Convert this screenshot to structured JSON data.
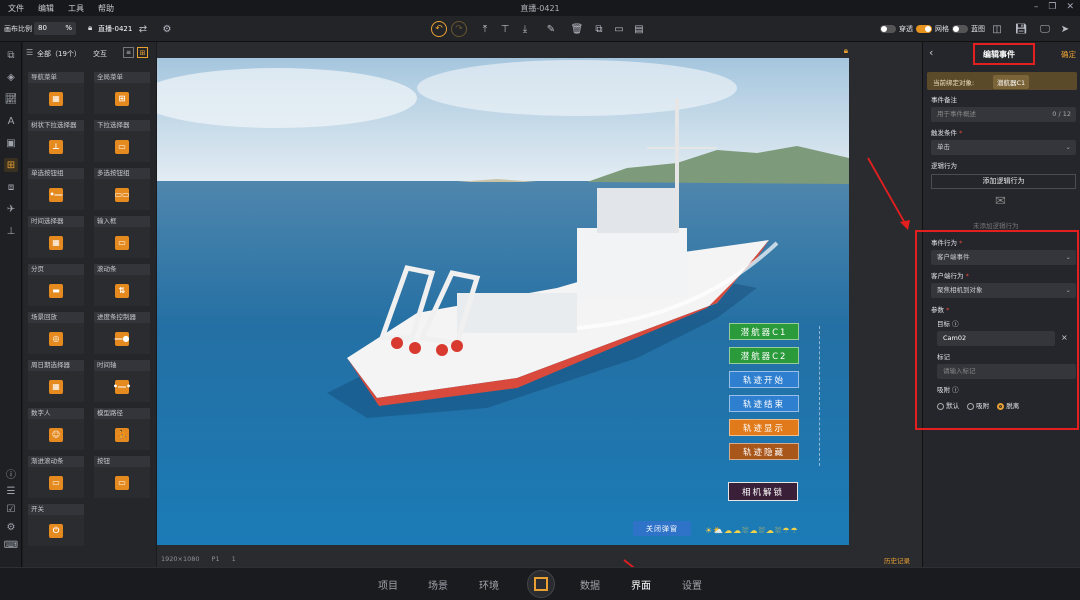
{
  "menu": {
    "items": [
      "文件",
      "编辑",
      "工具",
      "帮助"
    ],
    "title": "直播-0421"
  },
  "toolbar": {
    "scale_label": "画布比例",
    "scale_value": "80",
    "scale_unit": "%",
    "project_name": "直播-0421",
    "toggles": [
      {
        "label": "穿透",
        "on": false
      },
      {
        "label": "网格",
        "on": true
      },
      {
        "label": "蓝图",
        "on": false
      }
    ]
  },
  "components": {
    "filter_label": "全部（19个）",
    "tab_label": "交互",
    "items": [
      {
        "label": "导航菜单",
        "icon": "nav-menu-icon"
      },
      {
        "label": "全局菜单",
        "icon": "global-menu-icon"
      },
      {
        "label": "树状下拉选择器",
        "icon": "tree-select-icon"
      },
      {
        "label": "下拉选择器",
        "icon": "dropdown-icon"
      },
      {
        "label": "单选按钮组",
        "icon": "radio-group-icon"
      },
      {
        "label": "多选按钮组",
        "icon": "checkbox-group-icon"
      },
      {
        "label": "时间选择器",
        "icon": "time-picker-icon"
      },
      {
        "label": "输入框",
        "icon": "input-icon"
      },
      {
        "label": "分页",
        "icon": "pagination-icon"
      },
      {
        "label": "滚动条",
        "icon": "scrollbar-icon"
      },
      {
        "label": "场景回放",
        "icon": "replay-icon"
      },
      {
        "label": "进度条控制器",
        "icon": "progress-control-icon"
      },
      {
        "label": "周日期选择器",
        "icon": "week-picker-icon"
      },
      {
        "label": "时间轴",
        "icon": "timeline-icon"
      },
      {
        "label": "数字人",
        "icon": "digital-human-icon"
      },
      {
        "label": "模型路径",
        "icon": "model-path-icon"
      },
      {
        "label": "渐进滚动条",
        "icon": "progressive-scroll-icon"
      },
      {
        "label": "按钮",
        "icon": "button-icon"
      },
      {
        "label": "开关",
        "icon": "switch-icon"
      }
    ]
  },
  "scene": {
    "buttons": [
      {
        "label": "潜航器C1",
        "color": "#2a9a3a"
      },
      {
        "label": "潜航器C2",
        "color": "#2a9a3a"
      },
      {
        "label": "轨迹开始",
        "color": "#2f7fd0"
      },
      {
        "label": "轨迹结束",
        "color": "#2f7fd0"
      },
      {
        "label": "轨迹显示",
        "color": "#e07a1a"
      },
      {
        "label": "轨迹隐藏",
        "color": "#a9561a"
      }
    ],
    "camera_unlock": "相机解锁",
    "close_popup": "关闭弹窗"
  },
  "status": {
    "resolution": "1920×1080",
    "page": "P1",
    "count": "1",
    "history": "历史记录"
  },
  "panel": {
    "back": "‹",
    "title": "编辑事件",
    "confirm": "确定",
    "bound_label": "当前绑定对象:",
    "bound_value": "潜航器C1",
    "note_label": "事件备注",
    "note_placeholder": "用于事件概述",
    "note_count": "0 / 12",
    "trigger_label": "触发条件",
    "trigger_value": "单击",
    "logic_label": "逻辑行为",
    "add_logic": "添加逻辑行为",
    "no_logic": "未添加逻辑行为",
    "event_action_label": "事件行为",
    "event_action_value": "客户端事件",
    "client_action_label": "客户端行为",
    "client_action_value": "聚焦相机到对象",
    "params_label": "参数",
    "target_label": "目标",
    "target_value": "Cam02",
    "mark_label": "标记",
    "mark_placeholder": "请输入标记",
    "attach_label": "吸附",
    "attach_options": [
      {
        "label": "默认",
        "selected": false
      },
      {
        "label": "吸附",
        "selected": false
      },
      {
        "label": "脱离",
        "selected": true
      }
    ]
  },
  "nav": {
    "items": [
      "项目",
      "场景",
      "环境",
      "数据",
      "界面",
      "设置"
    ],
    "active": "界面"
  },
  "accent": "#e8a033"
}
